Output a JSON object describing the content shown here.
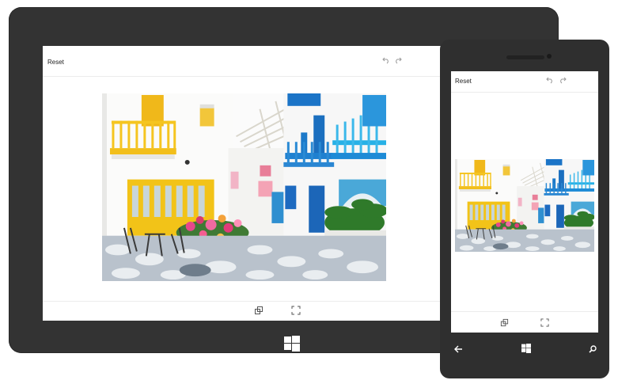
{
  "tablet": {
    "toolbar": {
      "reset_label": "Reset"
    }
  },
  "phone": {
    "toolbar": {
      "reset_label": "Reset"
    }
  },
  "icons": {
    "undo": "undo-icon",
    "redo": "redo-icon",
    "crop": "crop-icon",
    "fit": "fit-to-screen-icon",
    "windows": "windows-logo-icon",
    "back": "back-arrow-icon",
    "search": "search-icon"
  },
  "colors": {
    "device_bezel": "#333333",
    "toolbar_border": "#ececec",
    "icon_gray": "#9a9a9a",
    "balcony_yellow": "#f2c318",
    "balcony_blue": "#1f7ac8"
  }
}
